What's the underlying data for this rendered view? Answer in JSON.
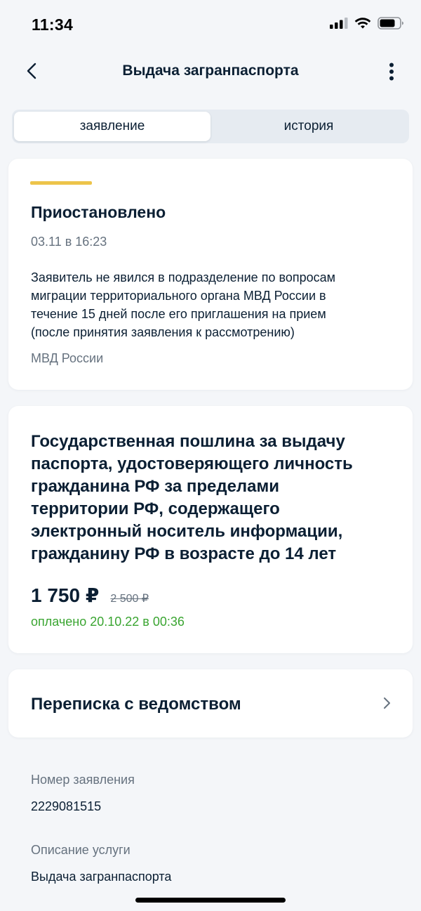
{
  "status_bar": {
    "time": "11:34"
  },
  "header": {
    "title": "Выдача загранпаспорта",
    "back_icon": "chevron-left-icon",
    "more_icon": "more-vertical-icon"
  },
  "tabs": [
    {
      "label": "заявление",
      "active": true
    },
    {
      "label": "история",
      "active": false
    }
  ],
  "status_card": {
    "accent_color": "#edc44a",
    "title": "Приостановлено",
    "date": "03.11 в 16:23",
    "description_lines": [
      "Заявитель не явился в подразделение по вопросам",
      "миграции территориального органа МВД России в",
      "течение 15 дней после его приглашения на прием",
      "(после принятия заявления к рассмотрению)"
    ],
    "agency": "МВД России"
  },
  "payment_card": {
    "title_lines": [
      "Государственная пошлина за выдачу",
      "паспорта, удостоверяющего личность",
      "гражданина РФ за пределами",
      "территории РФ, содержащего",
      "электронный носитель информации,",
      "гражданину РФ в возрасте до 14 лет"
    ],
    "price": "1 750 ₽",
    "old_price": "2 500 ₽",
    "paid_status": "оплачено 20.10.22 в 00:36",
    "paid_color": "#3aa531"
  },
  "correspondence": {
    "label": "Переписка с ведомством",
    "icon": "chevron-right-icon"
  },
  "details": {
    "application_number_label": "Номер заявления",
    "application_number": "2229081515",
    "service_description_label": "Описание услуги",
    "service_description": "Выдача загранпаспорта"
  }
}
